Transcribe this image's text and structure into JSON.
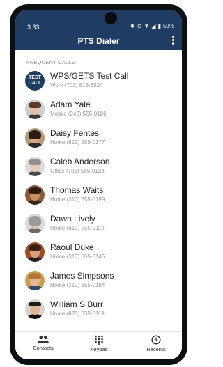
{
  "status_bar": {
    "time": "3:33",
    "battery": "59%"
  },
  "header": {
    "title": "PTS Dialer"
  },
  "section_label": "FREQUENT CALLS",
  "contacts": [
    {
      "name": "WPS/GETS Test Call",
      "type": "Work",
      "phone": "(703) 818-3924",
      "avatar_text_1": "TEST",
      "avatar_text_2": "CALL"
    },
    {
      "name": "Adam Yale",
      "type": "Mobile",
      "phone": "(240) 555-0186"
    },
    {
      "name": "Daisy Fentes",
      "type": "Home",
      "phone": "(810) 555-0177"
    },
    {
      "name": "Caleb Anderson",
      "type": "Office",
      "phone": "(703) 555-0123"
    },
    {
      "name": "Thomas Waits",
      "type": "Home",
      "phone": "(310) 555-0199"
    },
    {
      "name": "Dawn Lively",
      "type": "Home",
      "phone": "(410) 555-0112"
    },
    {
      "name": "Raoul Duke",
      "type": "Home",
      "phone": "(313) 555-0145"
    },
    {
      "name": "James Simpsons",
      "type": "Home",
      "phone": "(212) 555-0194"
    },
    {
      "name": "William S Burr",
      "type": "Home",
      "phone": "(876) 555-0119"
    }
  ],
  "nav": {
    "contacts": "Contacts",
    "keypad": "Keypad",
    "recents": "Recents"
  },
  "colors": {
    "header": "#1f3d63",
    "accent": "#1f3d63"
  }
}
